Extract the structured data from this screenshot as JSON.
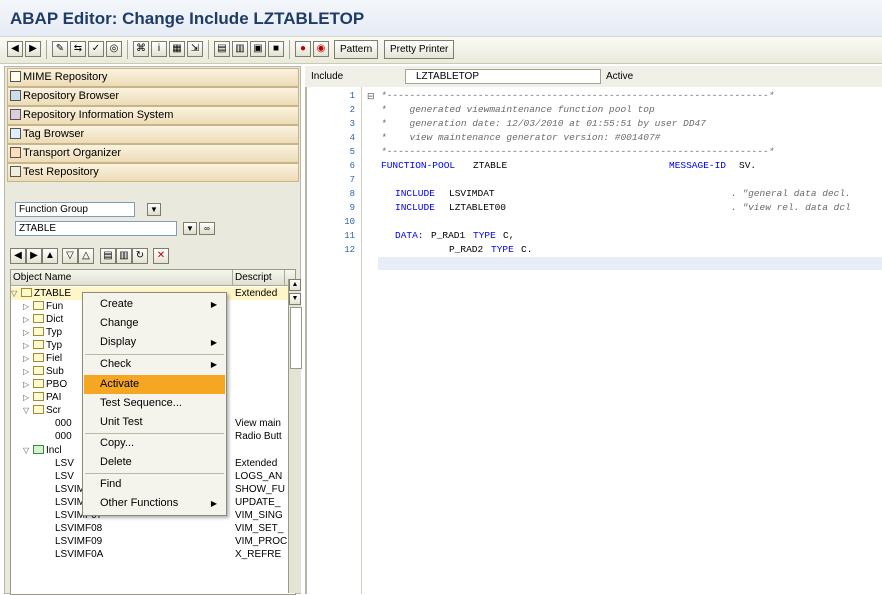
{
  "title": "ABAP Editor: Change Include LZTABLETOP",
  "toolbar": {
    "pattern_label": "Pattern",
    "pretty_printer_label": "Pretty Printer"
  },
  "left_nav": [
    {
      "label": "MIME Repository"
    },
    {
      "label": "Repository Browser"
    },
    {
      "label": "Repository Information System"
    },
    {
      "label": "Tag Browser"
    },
    {
      "label": "Transport Organizer"
    },
    {
      "label": "Test Repository"
    }
  ],
  "object_selector": {
    "type_value": "Function Group",
    "name_value": "ZTABLE"
  },
  "tree": {
    "col_object_name": "Object Name",
    "col_description": "Descript",
    "root": {
      "name": "ZTABLE",
      "desc": "Extended"
    },
    "items": [
      {
        "name": "Fun",
        "desc": ""
      },
      {
        "name": "Dict",
        "desc": ""
      },
      {
        "name": "Typ",
        "desc": ""
      },
      {
        "name": "Typ",
        "desc": ""
      },
      {
        "name": "Fiel",
        "desc": ""
      },
      {
        "name": "Sub",
        "desc": ""
      },
      {
        "name": "PBO",
        "desc": ""
      },
      {
        "name": "PAI",
        "desc": ""
      },
      {
        "name": "Scr",
        "desc": ""
      },
      {
        "name": "000",
        "desc": "View main"
      },
      {
        "name": "000",
        "desc": "Radio Butt"
      },
      {
        "name": "Incl",
        "desc": ""
      },
      {
        "name": "LSV",
        "desc": "Extended"
      },
      {
        "name": "LSV",
        "desc": "LOGS_AN"
      },
      {
        "name": "LSVIMF05",
        "desc": "SHOW_FU"
      },
      {
        "name": "LSVIMF06",
        "desc": "UPDATE_"
      },
      {
        "name": "LSVIMF07",
        "desc": "VIM_SING"
      },
      {
        "name": "LSVIMF08",
        "desc": "VIM_SET_"
      },
      {
        "name": "LSVIMF09",
        "desc": "VIM_PROC"
      },
      {
        "name": "LSVIMF0A",
        "desc": "X_REFRE"
      }
    ]
  },
  "context_menu": {
    "items": [
      {
        "label": "Create",
        "submenu": true
      },
      {
        "label": "Change",
        "submenu": false
      },
      {
        "label": "Display",
        "submenu": true
      },
      {
        "label": "Check",
        "submenu": true
      },
      {
        "label": "Activate",
        "submenu": false
      },
      {
        "label": "Test Sequence...",
        "submenu": false
      },
      {
        "label": "Unit Test",
        "submenu": false
      },
      {
        "label": "Copy...",
        "submenu": false
      },
      {
        "label": "Delete",
        "submenu": false
      },
      {
        "label": "Find",
        "submenu": false
      },
      {
        "label": "Other Functions",
        "submenu": true
      }
    ],
    "highlighted": "Activate",
    "highlight_color": "#f5a623"
  },
  "editor": {
    "include_label": "Include",
    "include_name": "LZTABLETOP",
    "status": "Active",
    "line_numbers": [
      "1",
      "2",
      "3",
      "4",
      "5",
      "6",
      "7",
      "8",
      "9",
      "10",
      "11",
      "12"
    ],
    "lines": {
      "l1": "*-------------------------------------------------------------------*",
      "l2": "*    generated viewmaintenance function pool top",
      "l3": "*    generation date: 12/03/2010 at 01:55:51 by user DD47",
      "l4": "*    view maintenance generator version: #001407#",
      "l5": "*-------------------------------------------------------------------*",
      "l6_kw1": "FUNCTION-POOL",
      "l6_name": "ZTABLE",
      "l6_kw2": "MESSAGE-ID",
      "l6_msg": "SV.",
      "l8_kw": "INCLUDE",
      "l8_name": "LSVIMDAT",
      "l8_cmt": ". \"general data decl.",
      "l9_kw": "INCLUDE",
      "l9_name": "LZTABLET00",
      "l9_cmt": ". \"view rel. data dcl",
      "l11_kw": "DATA:",
      "l11_var": "P_RAD1",
      "l11_type_kw": "TYPE",
      "l11_type": "C,",
      "l12_var": "P_RAD2",
      "l12_type_kw": "TYPE",
      "l12_type": "C."
    }
  }
}
